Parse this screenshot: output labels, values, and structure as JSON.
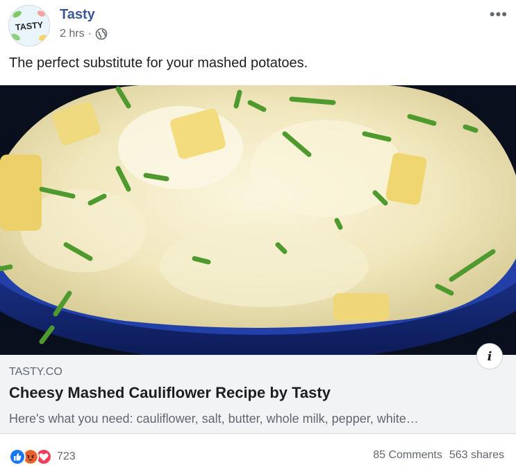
{
  "post": {
    "page_name": "Tasty",
    "avatar_text": "TASTY",
    "timestamp": "2 hrs",
    "separator": "·",
    "privacy_icon": "globe-icon",
    "more_icon": "ellipsis-icon",
    "more_text": "•••",
    "caption": "The perfect substitute for your mashed potatoes."
  },
  "link_preview": {
    "domain": "TASTY.CO",
    "title": "Cheesy Mashed Cauliflower Recipe by Tasty",
    "description": "Here's what you need: cauliflower, salt, butter, whole milk, pepper, white…",
    "info_icon": "i"
  },
  "footer": {
    "reaction_icons": [
      "like-icon",
      "angry-icon",
      "love-icon"
    ],
    "reaction_count": "723",
    "comments": "85 Comments",
    "shares": "563 shares"
  },
  "colors": {
    "page_name": "#385898",
    "like": "#1877f2",
    "angry": "#f0883a",
    "love": "#f33e58",
    "bowl": "#1f3f9e"
  }
}
